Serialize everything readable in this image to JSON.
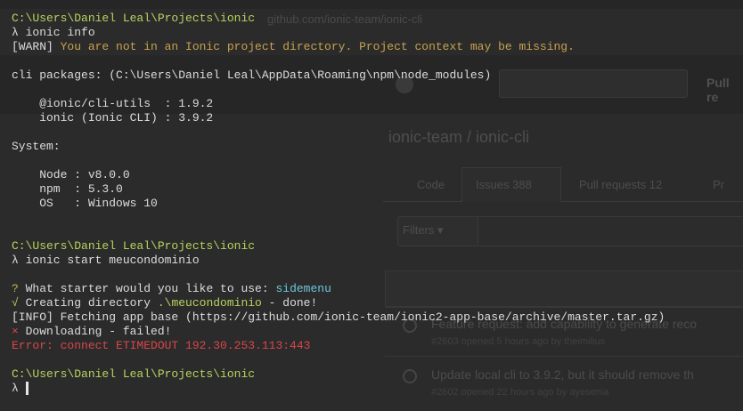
{
  "background_browser": {
    "url_text": "github.com/ionic-team/ionic-cli",
    "pull_label": "Pull re",
    "repo_title": "ionic-team / ionic-cli",
    "tabs": [
      "Code",
      "Issues 388",
      "Pull requests 12",
      "Pr"
    ],
    "filters_label": "Filters ▾",
    "issues": [
      {
        "title": "Feature request: add capability to generate reco",
        "sub": "#2603 opened 5 hours ago by theimilius"
      },
      {
        "title": "Update local cli to 3.9.2, but it should remove th",
        "sub": "#2602 opened 22 hours ago by ayesenia"
      }
    ]
  },
  "terminal": {
    "lines": [
      {
        "segments": [
          {
            "text": "C:\\Users\\Daniel Leal\\Projects\\ionic",
            "cls": "path"
          }
        ]
      },
      {
        "segments": [
          {
            "text": "λ ionic info",
            "cls": ""
          }
        ]
      },
      {
        "segments": [
          {
            "text": "[WARN] ",
            "cls": "warn-prefix"
          },
          {
            "text": "You are not in an Ionic project directory. Project context may be missing.",
            "cls": "warn-msg"
          }
        ]
      },
      {
        "segments": []
      },
      {
        "segments": [
          {
            "text": "cli packages: (C:\\Users\\Daniel Leal\\AppData\\Roaming\\npm\\node_modules)",
            "cls": ""
          }
        ]
      },
      {
        "segments": []
      },
      {
        "segments": [
          {
            "text": "    @ionic/cli-utils  : 1.9.2",
            "cls": ""
          }
        ]
      },
      {
        "segments": [
          {
            "text": "    ionic (Ionic CLI) : 3.9.2",
            "cls": ""
          }
        ]
      },
      {
        "segments": []
      },
      {
        "segments": [
          {
            "text": "System:",
            "cls": ""
          }
        ]
      },
      {
        "segments": []
      },
      {
        "segments": [
          {
            "text": "    Node : v8.0.0",
            "cls": ""
          }
        ]
      },
      {
        "segments": [
          {
            "text": "    npm  : 5.3.0",
            "cls": ""
          }
        ]
      },
      {
        "segments": [
          {
            "text": "    OS   : Windows 10",
            "cls": ""
          }
        ]
      },
      {
        "segments": []
      },
      {
        "segments": []
      },
      {
        "segments": [
          {
            "text": "C:\\Users\\Daniel Leal\\Projects\\ionic",
            "cls": "path"
          }
        ]
      },
      {
        "segments": [
          {
            "text": "λ ionic start meucondominio",
            "cls": ""
          }
        ]
      },
      {
        "segments": []
      },
      {
        "segments": [
          {
            "text": "? ",
            "cls": "q-mark"
          },
          {
            "text": "What starter would you like to use: ",
            "cls": ""
          },
          {
            "text": "sidemenu",
            "cls": "cyan"
          }
        ]
      },
      {
        "segments": [
          {
            "text": "√ ",
            "cls": "check-mark"
          },
          {
            "text": "Creating directory ",
            "cls": ""
          },
          {
            "text": ".\\meucondominio",
            "cls": "check-mark"
          },
          {
            "text": " - done!",
            "cls": ""
          }
        ]
      },
      {
        "segments": [
          {
            "text": "[INFO] Fetching app base (https://github.com/ionic-team/ionic2-app-base/archive/master.tar.gz)",
            "cls": ""
          }
        ]
      },
      {
        "segments": [
          {
            "text": "× ",
            "cls": "red"
          },
          {
            "text": "Downloading - failed!",
            "cls": ""
          }
        ]
      },
      {
        "segments": [
          {
            "text": "Error: connect ETIMEDOUT 192.30.253.113:443",
            "cls": "red"
          }
        ]
      },
      {
        "segments": []
      },
      {
        "segments": [
          {
            "text": "C:\\Users\\Daniel Leal\\Projects\\ionic",
            "cls": "path"
          }
        ]
      },
      {
        "segments": [
          {
            "text": "λ ",
            "cls": ""
          }
        ]
      }
    ]
  }
}
